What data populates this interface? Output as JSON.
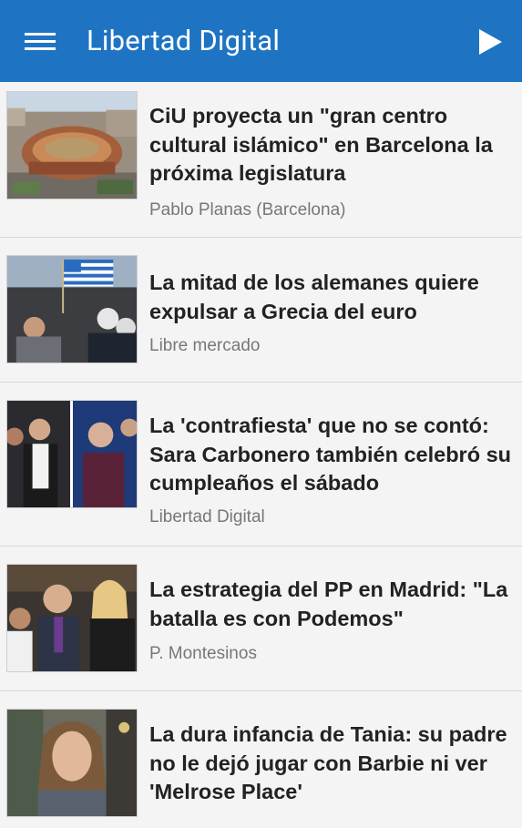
{
  "appbar": {
    "title": "Libertad Digital",
    "menu_icon": "menu-icon",
    "play_icon": "play-icon",
    "color": "#1e74c3"
  },
  "articles": [
    {
      "headline": "CiU proyecta un \"gran centro cultural islámico\" en Barcelona la próxima legislatura",
      "source": "Pablo Planas (Barcelona)"
    },
    {
      "headline": "La mitad de los alemanes quiere expulsar a Grecia del euro",
      "source": "Libre mercado"
    },
    {
      "headline": "La 'contrafiesta' que no se contó: Sara Carbonero también celebró su cumpleaños el sábado",
      "source": "Libertad Digital"
    },
    {
      "headline": "La estrategia del PP en Madrid: \"La batalla es con Podemos\"",
      "source": "P. Montesinos"
    },
    {
      "headline": "La dura infancia de Tania: su padre no le dejó jugar con Barbie ni ver 'Melrose Place'",
      "source": ""
    }
  ]
}
